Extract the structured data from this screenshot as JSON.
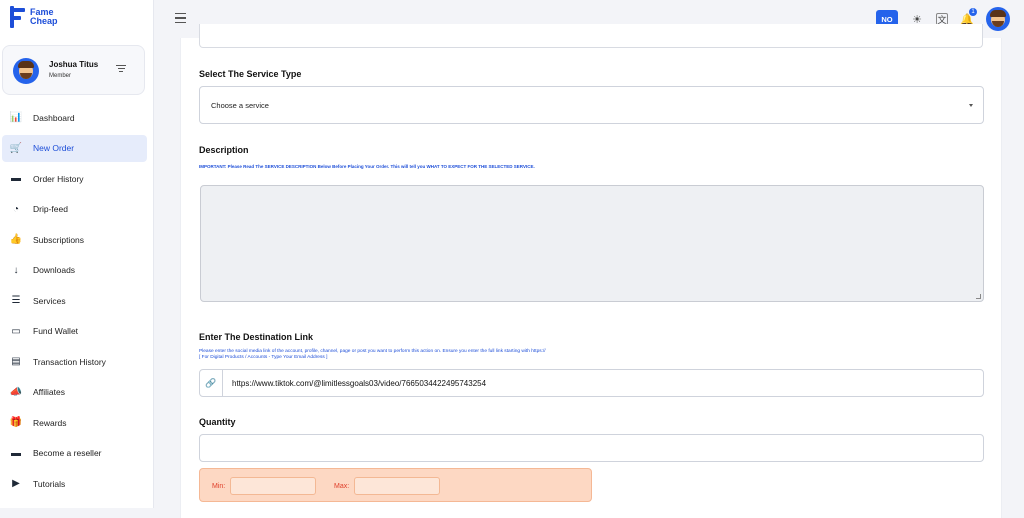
{
  "brand": {
    "name_line1": "Fame",
    "name_line2": "Cheap",
    "color": "#1d4ed8"
  },
  "profile": {
    "name": "Joshua Titus",
    "role": "Member"
  },
  "sidebar": {
    "items": [
      {
        "label": "Dashboard",
        "icon": "chart-icon",
        "glyph": "📊",
        "active": false
      },
      {
        "label": "New Order",
        "icon": "cart-icon",
        "glyph": "🛒",
        "active": true
      },
      {
        "label": "Order History",
        "icon": "calendar-icon",
        "glyph": "▬",
        "active": false
      },
      {
        "label": "Drip-feed",
        "icon": "clock-icon",
        "glyph": "◔",
        "active": false
      },
      {
        "label": "Subscriptions",
        "icon": "thumbs-up-icon",
        "glyph": "👍",
        "active": false
      },
      {
        "label": "Downloads",
        "icon": "arrow-down-icon",
        "glyph": "↓",
        "active": false
      },
      {
        "label": "Services",
        "icon": "list-icon",
        "glyph": "☰",
        "active": false
      },
      {
        "label": "Fund Wallet",
        "icon": "wallet-icon",
        "glyph": "▭",
        "active": false
      },
      {
        "label": "Transaction History",
        "icon": "receipt-icon",
        "glyph": "▤",
        "active": false
      },
      {
        "label": "Affiliates",
        "icon": "megaphone-icon",
        "glyph": "📣",
        "active": false
      },
      {
        "label": "Rewards",
        "icon": "gift-icon",
        "glyph": "🎁",
        "active": false
      },
      {
        "label": "Become a reseller",
        "icon": "store-icon",
        "glyph": "▬",
        "active": false
      },
      {
        "label": "Tutorials",
        "icon": "play-circle-icon",
        "glyph": "▶",
        "active": false
      }
    ]
  },
  "header": {
    "currency_badge": "NO",
    "notification_count": "1"
  },
  "form": {
    "service_type": {
      "label": "Select The Service Type",
      "placeholder": "Choose a service"
    },
    "description": {
      "label": "Description",
      "notice": "IMPORTANT: Please Read The SERVICE DESCRIPTION Below Before Placing Your Order. This will tell you WHAT TO EXPECT FOR THE SELECTED SERVICE."
    },
    "destination": {
      "label": "Enter The Destination Link",
      "help_line1": "Please enter the social media link of the account, profile, channel, page or post you want to perform this action on. Ensure you enter the full link starting with https://",
      "help_line2": "[ For Digital Products / Accounts - Type Your Email Address ]",
      "value": "https://www.tiktok.com/@limitlessgoals03/video/7665034422495743254"
    },
    "quantity": {
      "label": "Quantity",
      "min_label": "Min:",
      "max_label": "Max:"
    }
  }
}
